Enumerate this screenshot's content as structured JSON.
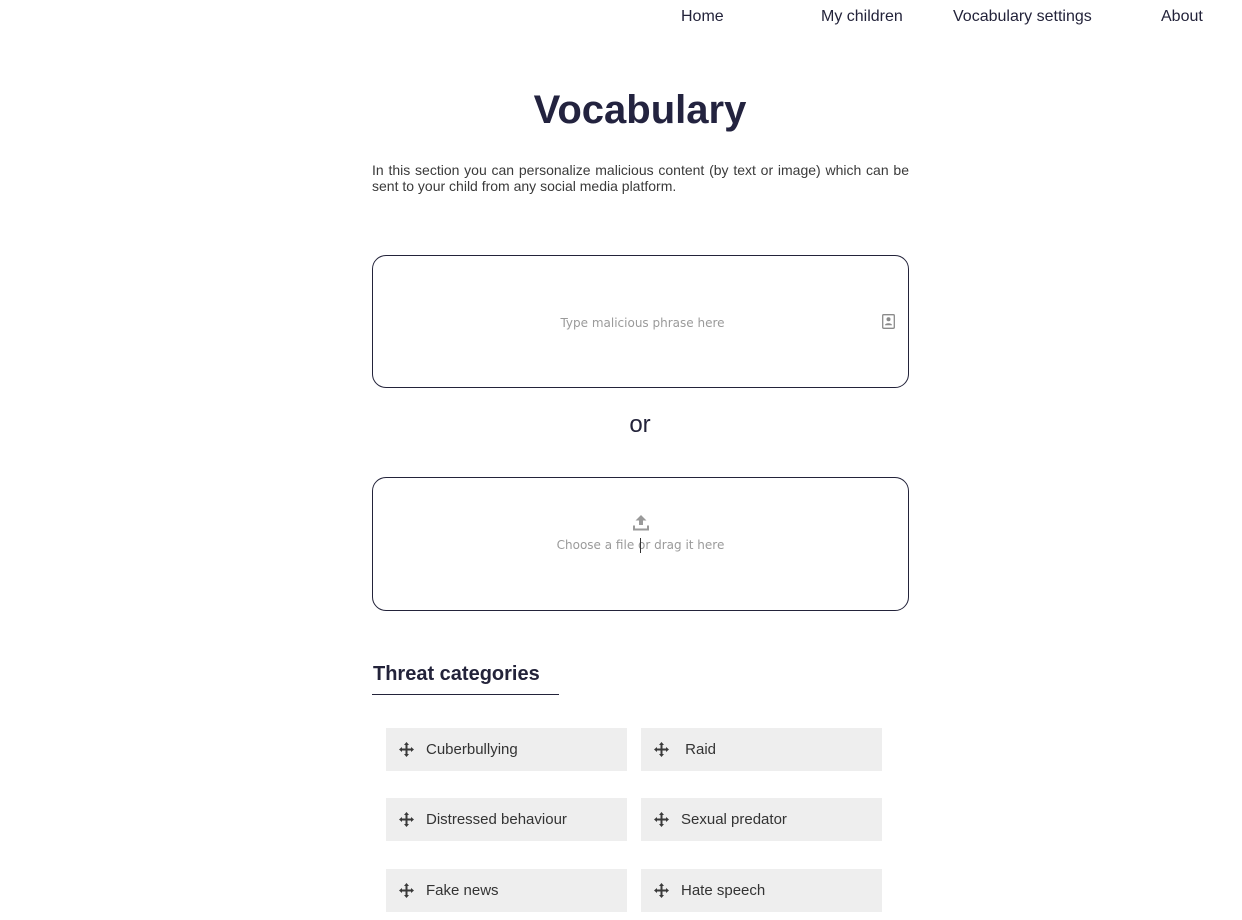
{
  "nav": {
    "items": [
      {
        "label": "Home"
      },
      {
        "label": "My children"
      },
      {
        "label": "Vocabulary settings"
      },
      {
        "label": "About"
      }
    ]
  },
  "page": {
    "title": "Vocabulary",
    "description": "In this section you can personalize malicious content (by text or image) which can be sent to your child from any social media platform."
  },
  "phrase_input": {
    "placeholder": "Type malicious phrase here",
    "value": "",
    "icon": "contact-card-icon"
  },
  "separator": {
    "text": "or"
  },
  "upload": {
    "label": "Choose a file or drag it here",
    "icon": "upload-icon"
  },
  "threat_categories": {
    "title": "Threat categories",
    "items": [
      {
        "label": "Cuberbullying",
        "icon": "move-icon"
      },
      {
        "label": " Raid",
        "icon": "move-icon"
      },
      {
        "label": "Distressed behaviour",
        "icon": "move-icon"
      },
      {
        "label": "Sexual predator",
        "icon": "move-icon"
      },
      {
        "label": "Fake news",
        "icon": "move-icon"
      },
      {
        "label": "Hate speech",
        "icon": "move-icon"
      }
    ]
  },
  "colors": {
    "text_dark": "#23233a",
    "chip_bg": "#eeeeee",
    "placeholder": "#9a9a9a",
    "icon_gray": "#9a9a9a"
  }
}
